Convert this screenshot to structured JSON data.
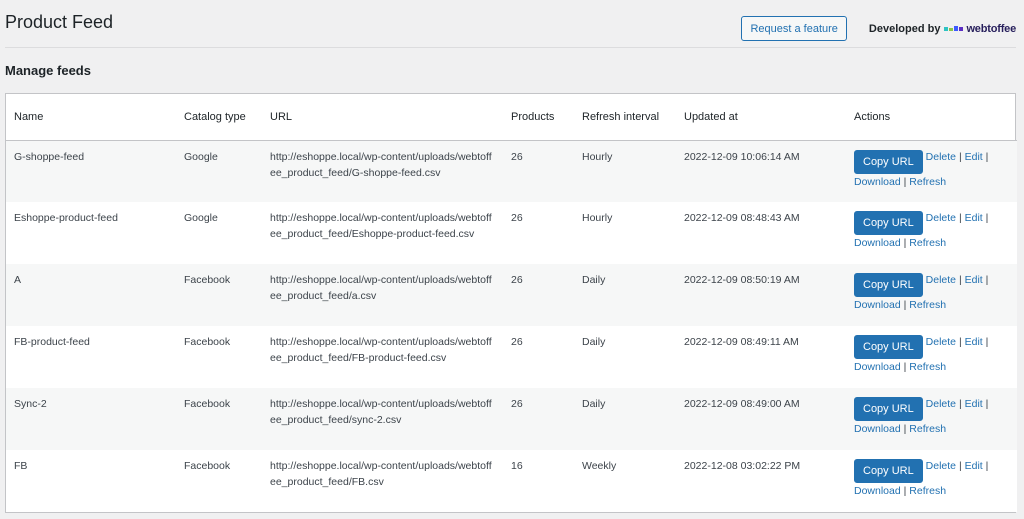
{
  "header": {
    "title": "Product Feed",
    "request_button": "Request a feature",
    "developed_by": "Developed by",
    "brand_name": "webtoffee",
    "brand_colors": [
      "#2ec3c3",
      "#8bc34a",
      "#3d5afe",
      "#5c2ec3"
    ]
  },
  "section": {
    "title": "Manage feeds"
  },
  "table": {
    "columns": [
      "Name",
      "Catalog type",
      "URL",
      "Products",
      "Refresh interval",
      "Updated at",
      "Actions"
    ],
    "rows": [
      {
        "name": "G-shoppe-feed",
        "catalog": "Google",
        "url": "http://eshoppe.local/wp-content/uploads/webtoffee_product_feed/G-shoppe-feed.csv",
        "products": "26",
        "interval": "Hourly",
        "updated": "2022-12-09 10:06:14 AM"
      },
      {
        "name": "Eshoppe-product-feed",
        "catalog": "Google",
        "url": "http://eshoppe.local/wp-content/uploads/webtoffee_product_feed/Eshoppe-product-feed.csv",
        "products": "26",
        "interval": "Hourly",
        "updated": "2022-12-09 08:48:43 AM"
      },
      {
        "name": "A",
        "catalog": "Facebook",
        "url": "http://eshoppe.local/wp-content/uploads/webtoffee_product_feed/a.csv",
        "products": "26",
        "interval": "Daily",
        "updated": "2022-12-09 08:50:19 AM"
      },
      {
        "name": "FB-product-feed",
        "catalog": "Facebook",
        "url": "http://eshoppe.local/wp-content/uploads/webtoffee_product_feed/FB-product-feed.csv",
        "products": "26",
        "interval": "Daily",
        "updated": "2022-12-09 08:49:11 AM"
      },
      {
        "name": "Sync-2",
        "catalog": "Facebook",
        "url": "http://eshoppe.local/wp-content/uploads/webtoffee_product_feed/sync-2.csv",
        "products": "26",
        "interval": "Daily",
        "updated": "2022-12-09 08:49:00 AM"
      },
      {
        "name": "FB",
        "catalog": "Facebook",
        "url": "http://eshoppe.local/wp-content/uploads/webtoffee_product_feed/FB.csv",
        "products": "16",
        "interval": "Weekly",
        "updated": "2022-12-08 03:02:22 PM"
      }
    ],
    "actions": {
      "copy": "Copy URL",
      "delete": "Delete",
      "edit": "Edit",
      "download": "Download",
      "refresh": "Refresh"
    }
  }
}
